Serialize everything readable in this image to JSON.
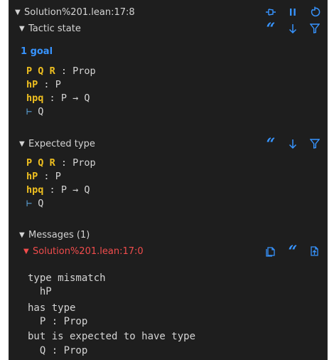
{
  "header": {
    "title": "Solution%201.lean:17:8"
  },
  "tactic_state": {
    "title": "Tactic state",
    "goal_count": "1 goal",
    "hyps": [
      {
        "names": [
          "P",
          "Q",
          "R"
        ],
        "sep": ":",
        "type": "Prop"
      },
      {
        "names": [
          "hP"
        ],
        "sep": ":",
        "type": "P"
      },
      {
        "names": [
          "hpq"
        ],
        "sep": ":",
        "type": "P → Q"
      }
    ],
    "turnstile": "⊢",
    "goal": "Q"
  },
  "expected_type": {
    "title": "Expected type",
    "hyps": [
      {
        "names": [
          "P",
          "Q",
          "R"
        ],
        "sep": ":",
        "type": "Prop"
      },
      {
        "names": [
          "hP"
        ],
        "sep": ":",
        "type": "P"
      },
      {
        "names": [
          "hpq"
        ],
        "sep": ":",
        "type": "P → Q"
      }
    ],
    "turnstile": "⊢",
    "goal": "Q"
  },
  "messages": {
    "title": "Messages (1)",
    "error_location": "Solution%201.lean:17:0",
    "lines": [
      "type mismatch",
      "  hP",
      "has type",
      "  P : Prop",
      "but is expected to have type",
      "  Q : Prop"
    ]
  },
  "colors": {
    "background": "#1e1e1e",
    "hypothesis_name": "#f0c020",
    "accent_blue": "#3794ff",
    "error_red": "#f14c4c"
  },
  "icons": [
    "pin-icon",
    "pause-icon",
    "refresh-icon",
    "quote-icon",
    "arrow-down-icon",
    "filter-icon",
    "copy-to-comment-icon",
    "go-to-location-icon"
  ]
}
